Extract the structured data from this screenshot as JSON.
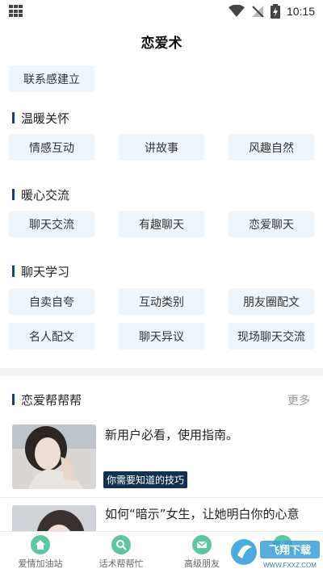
{
  "status_bar": {
    "time": "10:15"
  },
  "header": {
    "title": "恋爱术"
  },
  "top_tags": [
    "联系感建立"
  ],
  "sections": [
    {
      "title": "温暖关怀",
      "tags": [
        "情感互动",
        "讲故事",
        "风趣自然"
      ]
    },
    {
      "title": "暖心交流",
      "tags": [
        "聊天交流",
        "有趣聊天",
        "恋爱聊天"
      ]
    },
    {
      "title": "聊天学习",
      "tags": [
        "自卖自夸",
        "互动类别",
        "朋友圈配文",
        "名人配文",
        "聊天异议",
        "现场聊天交流"
      ]
    }
  ],
  "help": {
    "title": "恋爱帮帮帮",
    "more_label": "更多",
    "articles": [
      {
        "title": "新用户必看，使用指南。",
        "badge": "你需要知道的技巧"
      },
      {
        "title": "如何“暗示”女生，让她明白你的心意"
      }
    ]
  },
  "bottom_nav": {
    "items": [
      {
        "label": "爱情加油站",
        "icon": "home-icon",
        "color": "#57c39a"
      },
      {
        "label": "话术帮帮忙",
        "icon": "search-icon",
        "color": "#57c39a"
      },
      {
        "label": "高级朋友",
        "icon": "mail-icon",
        "color": "#57c39a"
      },
      {
        "label": "",
        "icon": "user-icon",
        "color": "#57c39a"
      }
    ]
  },
  "watermark": {
    "text": "飞翔下载",
    "url_text": "WWW.FXXZ.COM"
  },
  "colors": {
    "accent": "#1c3f6e",
    "tag_bg": "#eef5fb",
    "badge_bg": "#12304f",
    "nav_green": "#57c39a"
  }
}
